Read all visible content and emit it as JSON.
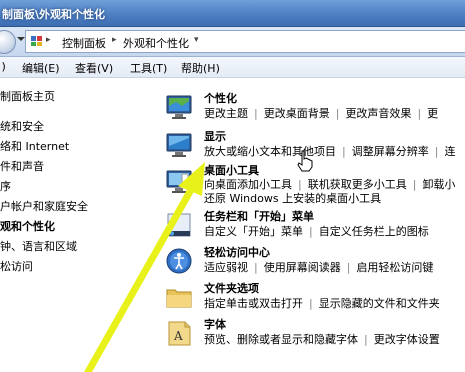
{
  "window": {
    "title": "制面板\\外观和个性化"
  },
  "address_bar": {
    "crumbs": [
      "控制面板",
      "外观和个性化"
    ]
  },
  "menu": {
    "items": [
      "文件(F)",
      "编辑(E)",
      "查看(V)",
      "工具(T)",
      "帮助(H)"
    ],
    "visible": [
      " )",
      "编辑(E)",
      "查看(V)",
      "工具(T)",
      "帮助(H)"
    ]
  },
  "sidebar": {
    "items": [
      {
        "label": "制面板主页",
        "bold": false
      },
      {
        "label": "统和安全",
        "bold": false
      },
      {
        "label": "络和 Internet",
        "bold": false
      },
      {
        "label": "件和声音",
        "bold": false
      },
      {
        "label": "序",
        "bold": false
      },
      {
        "label": "户帐户和家庭安全",
        "bold": false
      },
      {
        "label": "观和个性化",
        "bold": true
      },
      {
        "label": "钟、语言和区域",
        "bold": false
      },
      {
        "label": "松访问",
        "bold": false
      }
    ]
  },
  "categories": [
    {
      "title": "个性化",
      "links": [
        "更改主题",
        "更改桌面背景",
        "更改声音效果",
        "更"
      ]
    },
    {
      "title": "显示",
      "links": [
        "放大或缩小文本和其他项目",
        "调整屏幕分辨率",
        "连"
      ]
    },
    {
      "title": "桌面小工具",
      "links": [
        "向桌面添加小工具",
        "联机获取更多小工具",
        "卸载小"
      ],
      "links2": [
        "还原 Windows 上安装的桌面小工具"
      ]
    },
    {
      "title": "任务栏和「开始」菜单",
      "links": [
        "自定义「开始」菜单",
        "自定义任务栏上的图标"
      ]
    },
    {
      "title": "轻松访问中心",
      "links": [
        "适应弱视",
        "使用屏幕阅读器",
        "启用轻松访问键"
      ]
    },
    {
      "title": "文件夹选项",
      "links": [
        "指定单击或双击打开",
        "显示隐藏的文件和文件夹"
      ]
    },
    {
      "title": "字体",
      "links": [
        "预览、删除或者显示和隐藏字体",
        "更改字体设置"
      ]
    }
  ],
  "colors": {
    "titlebar": "#4a7cc0",
    "arrow": "#e8f21a"
  }
}
